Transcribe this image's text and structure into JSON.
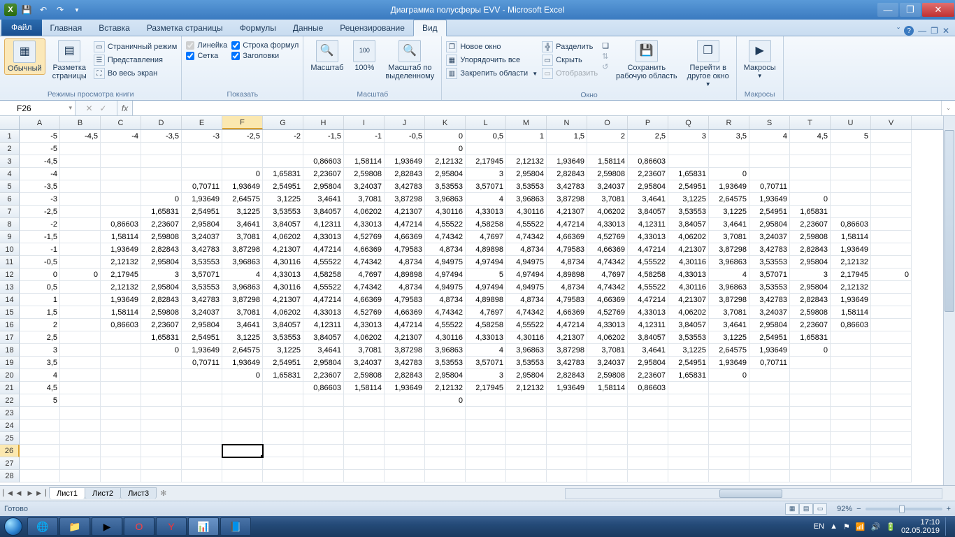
{
  "title": "Диаграмма полусферы EVV  -  Microsoft Excel",
  "tabs": {
    "file": "Файл",
    "home": "Главная",
    "insert": "Вставка",
    "layout": "Разметка страницы",
    "formulas": "Формулы",
    "data": "Данные",
    "review": "Рецензирование",
    "view": "Вид"
  },
  "ribbon": {
    "views_group": "Режимы просмотра книги",
    "normal": "Обычный",
    "page_layout": "Разметка\nстраницы",
    "page_break": "Страничный режим",
    "custom_views": "Представления",
    "full_screen": "Во весь экран",
    "show_group": "Показать",
    "ruler": "Линейка",
    "formula_bar": "Строка формул",
    "gridlines": "Сетка",
    "headings": "Заголовки",
    "zoom_group": "Масштаб",
    "zoom": "Масштаб",
    "z100": "100%",
    "zoom_sel": "Масштаб по\nвыделенному",
    "window_group": "Окно",
    "new_win": "Новое окно",
    "arrange": "Упорядочить все",
    "freeze": "Закрепить области",
    "split": "Разделить",
    "hide": "Скрыть",
    "unhide": "Отобразить",
    "save_ws": "Сохранить\nрабочую область",
    "switch": "Перейти в\nдругое окно",
    "macros_group": "Макросы",
    "macros": "Макросы"
  },
  "namebox": "F26",
  "columns": [
    "A",
    "B",
    "C",
    "D",
    "E",
    "F",
    "G",
    "H",
    "I",
    "J",
    "K",
    "L",
    "M",
    "N",
    "O",
    "P",
    "Q",
    "R",
    "S",
    "T",
    "U",
    "V"
  ],
  "active_col": "F",
  "active_row": 26,
  "rows": [
    [
      "-5",
      "-4,5",
      "-4",
      "-3,5",
      "-3",
      "-2,5",
      "-2",
      "-1,5",
      "-1",
      "-0,5",
      "0",
      "0,5",
      "1",
      "1,5",
      "2",
      "2,5",
      "3",
      "3,5",
      "4",
      "4,5",
      "5"
    ],
    [
      "-5",
      "",
      "",
      "",
      "",
      "",
      "",
      "",
      "",
      "",
      "0",
      "",
      "",
      "",
      "",
      "",
      "",
      "",
      "",
      "",
      ""
    ],
    [
      "-4,5",
      "",
      "",
      "",
      "",
      "",
      "",
      "0,86603",
      "1,58114",
      "1,93649",
      "2,12132",
      "2,17945",
      "2,12132",
      "1,93649",
      "1,58114",
      "0,86603",
      "",
      "",
      "",
      "",
      ""
    ],
    [
      "-4",
      "",
      "",
      "",
      "",
      "0",
      "1,65831",
      "2,23607",
      "2,59808",
      "2,82843",
      "2,95804",
      "3",
      "2,95804",
      "2,82843",
      "2,59808",
      "2,23607",
      "1,65831",
      "0",
      "",
      "",
      ""
    ],
    [
      "-3,5",
      "",
      "",
      "",
      "0,70711",
      "1,93649",
      "2,54951",
      "2,95804",
      "3,24037",
      "3,42783",
      "3,53553",
      "3,57071",
      "3,53553",
      "3,42783",
      "3,24037",
      "2,95804",
      "2,54951",
      "1,93649",
      "0,70711",
      "",
      ""
    ],
    [
      "-3",
      "",
      "",
      "0",
      "1,93649",
      "2,64575",
      "3,1225",
      "3,4641",
      "3,7081",
      "3,87298",
      "3,96863",
      "4",
      "3,96863",
      "3,87298",
      "3,7081",
      "3,4641",
      "3,1225",
      "2,64575",
      "1,93649",
      "0",
      "",
      ""
    ],
    [
      "-2,5",
      "",
      "",
      "1,65831",
      "2,54951",
      "3,1225",
      "3,53553",
      "3,84057",
      "4,06202",
      "4,21307",
      "4,30116",
      "4,33013",
      "4,30116",
      "4,21307",
      "4,06202",
      "3,84057",
      "3,53553",
      "3,1225",
      "2,54951",
      "1,65831",
      "",
      ""
    ],
    [
      "-2",
      "",
      "0,86603",
      "2,23607",
      "2,95804",
      "3,4641",
      "3,84057",
      "4,12311",
      "4,33013",
      "4,47214",
      "4,55522",
      "4,58258",
      "4,55522",
      "4,47214",
      "4,33013",
      "4,12311",
      "3,84057",
      "3,4641",
      "2,95804",
      "2,23607",
      "0,86603",
      ""
    ],
    [
      "-1,5",
      "",
      "1,58114",
      "2,59808",
      "3,24037",
      "3,7081",
      "4,06202",
      "4,33013",
      "4,52769",
      "4,66369",
      "4,74342",
      "4,7697",
      "4,74342",
      "4,66369",
      "4,52769",
      "4,33013",
      "4,06202",
      "3,7081",
      "3,24037",
      "2,59808",
      "1,58114",
      ""
    ],
    [
      "-1",
      "",
      "1,93649",
      "2,82843",
      "3,42783",
      "3,87298",
      "4,21307",
      "4,47214",
      "4,66369",
      "4,79583",
      "4,8734",
      "4,89898",
      "4,8734",
      "4,79583",
      "4,66369",
      "4,47214",
      "4,21307",
      "3,87298",
      "3,42783",
      "2,82843",
      "1,93649",
      ""
    ],
    [
      "-0,5",
      "",
      "2,12132",
      "2,95804",
      "3,53553",
      "3,96863",
      "4,30116",
      "4,55522",
      "4,74342",
      "4,8734",
      "4,94975",
      "4,97494",
      "4,94975",
      "4,8734",
      "4,74342",
      "4,55522",
      "4,30116",
      "3,96863",
      "3,53553",
      "2,95804",
      "2,12132",
      ""
    ],
    [
      "0",
      "0",
      "2,17945",
      "3",
      "3,57071",
      "4",
      "4,33013",
      "4,58258",
      "4,7697",
      "4,89898",
      "4,97494",
      "5",
      "4,97494",
      "4,89898",
      "4,7697",
      "4,58258",
      "4,33013",
      "4",
      "3,57071",
      "3",
      "2,17945",
      "0"
    ],
    [
      "0,5",
      "",
      "2,12132",
      "2,95804",
      "3,53553",
      "3,96863",
      "4,30116",
      "4,55522",
      "4,74342",
      "4,8734",
      "4,94975",
      "4,97494",
      "4,94975",
      "4,8734",
      "4,74342",
      "4,55522",
      "4,30116",
      "3,96863",
      "3,53553",
      "2,95804",
      "2,12132",
      ""
    ],
    [
      "1",
      "",
      "1,93649",
      "2,82843",
      "3,42783",
      "3,87298",
      "4,21307",
      "4,47214",
      "4,66369",
      "4,79583",
      "4,8734",
      "4,89898",
      "4,8734",
      "4,79583",
      "4,66369",
      "4,47214",
      "4,21307",
      "3,87298",
      "3,42783",
      "2,82843",
      "1,93649",
      ""
    ],
    [
      "1,5",
      "",
      "1,58114",
      "2,59808",
      "3,24037",
      "3,7081",
      "4,06202",
      "4,33013",
      "4,52769",
      "4,66369",
      "4,74342",
      "4,7697",
      "4,74342",
      "4,66369",
      "4,52769",
      "4,33013",
      "4,06202",
      "3,7081",
      "3,24037",
      "2,59808",
      "1,58114",
      ""
    ],
    [
      "2",
      "",
      "0,86603",
      "2,23607",
      "2,95804",
      "3,4641",
      "3,84057",
      "4,12311",
      "4,33013",
      "4,47214",
      "4,55522",
      "4,58258",
      "4,55522",
      "4,47214",
      "4,33013",
      "4,12311",
      "3,84057",
      "3,4641",
      "2,95804",
      "2,23607",
      "0,86603",
      ""
    ],
    [
      "2,5",
      "",
      "",
      "1,65831",
      "2,54951",
      "3,1225",
      "3,53553",
      "3,84057",
      "4,06202",
      "4,21307",
      "4,30116",
      "4,33013",
      "4,30116",
      "4,21307",
      "4,06202",
      "3,84057",
      "3,53553",
      "3,1225",
      "2,54951",
      "1,65831",
      "",
      ""
    ],
    [
      "3",
      "",
      "",
      "0",
      "1,93649",
      "2,64575",
      "3,1225",
      "3,4641",
      "3,7081",
      "3,87298",
      "3,96863",
      "4",
      "3,96863",
      "3,87298",
      "3,7081",
      "3,4641",
      "3,1225",
      "2,64575",
      "1,93649",
      "0",
      "",
      ""
    ],
    [
      "3,5",
      "",
      "",
      "",
      "0,70711",
      "1,93649",
      "2,54951",
      "2,95804",
      "3,24037",
      "3,42783",
      "3,53553",
      "3,57071",
      "3,53553",
      "3,42783",
      "3,24037",
      "2,95804",
      "2,54951",
      "1,93649",
      "0,70711",
      "",
      ""
    ],
    [
      "4",
      "",
      "",
      "",
      "",
      "0",
      "1,65831",
      "2,23607",
      "2,59808",
      "2,82843",
      "2,95804",
      "3",
      "2,95804",
      "2,82843",
      "2,59808",
      "2,23607",
      "1,65831",
      "0",
      "",
      "",
      ""
    ],
    [
      "4,5",
      "",
      "",
      "",
      "",
      "",
      "",
      "0,86603",
      "1,58114",
      "1,93649",
      "2,12132",
      "2,17945",
      "2,12132",
      "1,93649",
      "1,58114",
      "0,86603",
      "",
      "",
      "",
      "",
      ""
    ],
    [
      "5",
      "",
      "",
      "",
      "",
      "",
      "",
      "",
      "",
      "",
      "0",
      "",
      "",
      "",
      "",
      "",
      "",
      "",
      "",
      "",
      ""
    ]
  ],
  "sheets": [
    "Лист1",
    "Лист2",
    "Лист3"
  ],
  "status_ready": "Готово",
  "zoom_pct": "92%",
  "lang": "EN",
  "clock_time": "17:10",
  "clock_date": "02.05.2019"
}
